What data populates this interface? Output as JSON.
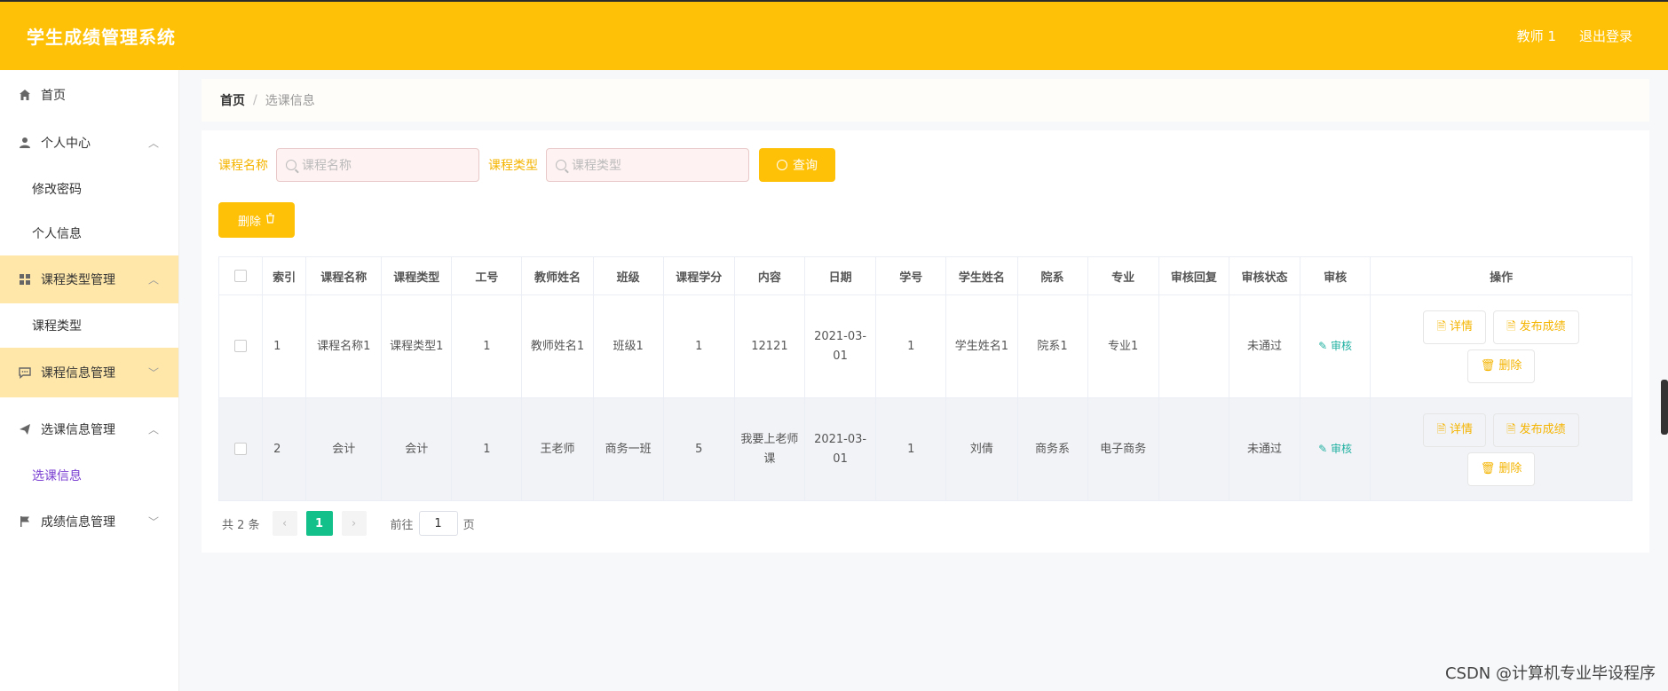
{
  "header": {
    "app_title": "学生成绩管理系统",
    "user_label": "教师 1",
    "logout_label": "退出登录"
  },
  "sidebar": {
    "home": "首页",
    "personal_center": "个人中心",
    "change_password": "修改密码",
    "personal_info": "个人信息",
    "course_type_mgmt": "课程类型管理",
    "course_type": "课程类型",
    "course_info_mgmt": "课程信息管理",
    "selection_info_mgmt": "选课信息管理",
    "selection_info": "选课信息",
    "grade_info_mgmt": "成绩信息管理"
  },
  "breadcrumb": {
    "home": "首页",
    "separator": "/",
    "current": "选课信息"
  },
  "search": {
    "course_name_label": "课程名称",
    "course_name_placeholder": "课程名称",
    "course_type_label": "课程类型",
    "course_type_placeholder": "课程类型",
    "query_label": "查询"
  },
  "toolbar": {
    "delete_label": "删除"
  },
  "table": {
    "headers": [
      "索引",
      "课程名称",
      "课程类型",
      "工号",
      "教师姓名",
      "班级",
      "课程学分",
      "内容",
      "日期",
      "学号",
      "学生姓名",
      "院系",
      "专业",
      "审核回复",
      "审核状态",
      "审核",
      "操作"
    ],
    "audit_link": "审核",
    "detail_label": "详情",
    "publish_label": "发布成绩",
    "delete_label": "删除",
    "rows": [
      {
        "index": "1",
        "course_name": "课程名称1",
        "course_type": "课程类型1",
        "staff_no": "1",
        "teacher": "教师姓名1",
        "class": "班级1",
        "credit": "1",
        "content": "12121",
        "date": "2021-03-01",
        "student_no": "1",
        "student_name": "学生姓名1",
        "department": "院系1",
        "major": "专业1",
        "reply": "",
        "status": "未通过"
      },
      {
        "index": "2",
        "course_name": "会计",
        "course_type": "会计",
        "staff_no": "1",
        "teacher": "王老师",
        "class": "商务一班",
        "credit": "5",
        "content": "我要上老师课",
        "date": "2021-03-01",
        "student_no": "1",
        "student_name": "刘倩",
        "department": "商务系",
        "major": "电子商务",
        "reply": "",
        "status": "未通过"
      }
    ]
  },
  "pagination": {
    "total": "共 2 条",
    "prev": "‹",
    "current": "1",
    "next": "›",
    "goto_prefix": "前往",
    "goto_value": "1",
    "goto_suffix": "页"
  },
  "watermark": "CSDN @计算机专业毕设程序"
}
